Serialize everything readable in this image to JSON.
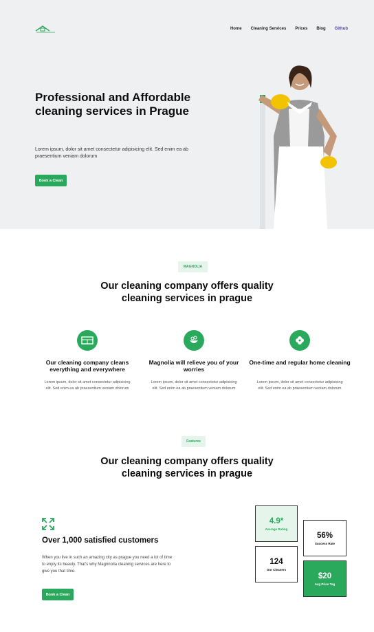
{
  "nav": {
    "items": [
      "Home",
      "Cleaning Services",
      "Prices",
      "Blog"
    ],
    "github": "Github"
  },
  "hero": {
    "title": "Professional and Affordable cleaning services in Prague",
    "text": "Lorem ipsum, dolor sit amet consectetur adipisicing elit. Sed enim ea ab praesentium veniam dolorum",
    "button": "Book a Clean"
  },
  "section1": {
    "tag": "MAGNOLIA",
    "title": "Our cleaning company offers quality cleaning services in prague"
  },
  "features": [
    {
      "icon": "cabinet-icon",
      "title": "Our cleaning company cleans everything and everywhere",
      "text": "Lorem ipsum, dolor sit amet consectetur adipisicing elit. Sed enim ea ab praesentium veniam dolorum"
    },
    {
      "icon": "bowl-icon",
      "title": "Magnolia will relieve you of your worries",
      "text": "Lorem ipsum, dolor sit amet consectetur adipisicing elit. Sed enim ea ab praesentium veniam dolorum"
    },
    {
      "icon": "flower-icon",
      "title": "One-time and regular home cleaning",
      "text": "Lorem ipsum, dolor sit amet consectetur adipisicing elit. Sed enim ea ab praesentium veniam dolorum"
    }
  ],
  "section2": {
    "tag": "Features",
    "title": "Our cleaning company offers quality cleaning services in prague"
  },
  "customers": {
    "title": "Over 1,000 satisfied customers",
    "text": "When you live in such an amazing city as prague you need a lot of time to enjoy its beauty. That's why Magnnolia cleaning services are here to give you that time.",
    "button": "Book a Clean"
  },
  "stats": {
    "rating": {
      "value": "4.9*",
      "label": "Average Rating"
    },
    "success": {
      "value": "56%",
      "label": "Success Rate"
    },
    "cleaners": {
      "value": "124",
      "label": "Our Cleaners"
    },
    "price": {
      "value": "$20",
      "label": "Avg Price Tag"
    }
  },
  "colors": {
    "accent": "#2aa85b",
    "hero_bg": "#eef0f2",
    "github": "#4b3fb2"
  }
}
